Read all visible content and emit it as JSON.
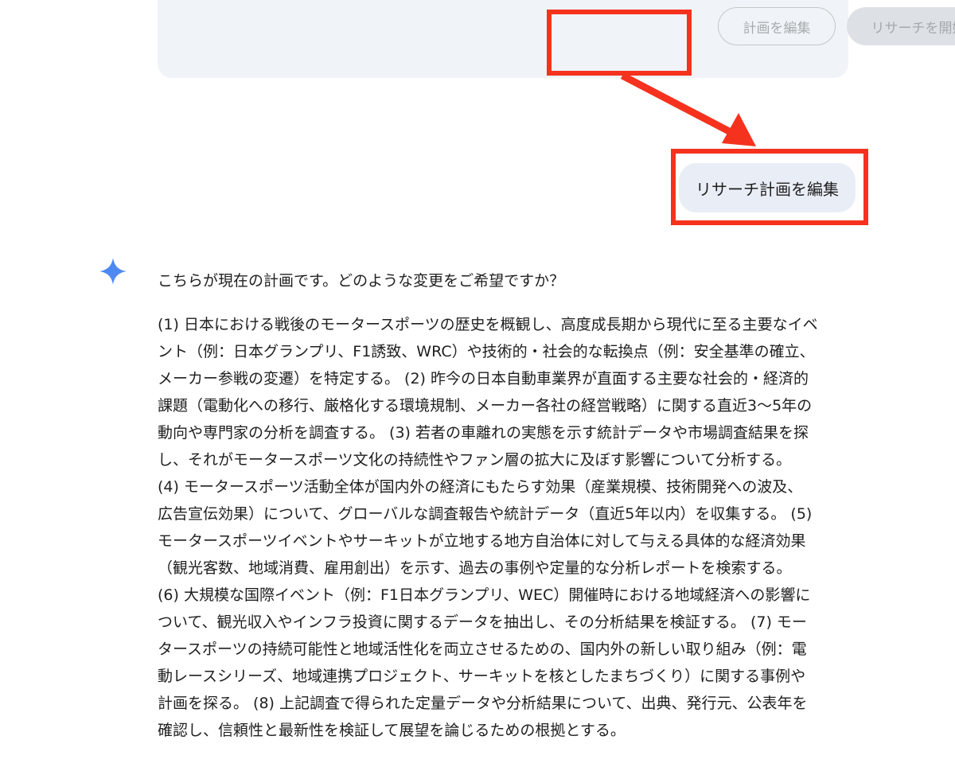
{
  "plan_card": {
    "edit_plan_label": "計画を編集",
    "start_research_label": "リサーチを開始"
  },
  "user_message": "リサーチ計画を編集",
  "assistant": {
    "icon": "gemini-sparkle-icon",
    "intro": "こちらが現在の計画です。どのような変更をご希望ですか？",
    "plan_lines": [
      "(1) 日本における戦後のモータースポーツの歴史を概観し、高度成長期から現代に至る主要なイベ",
      "ント（例：日本グランプリ、F1誘致、WRC）や技術的・社会的な転換点（例：安全基準の確立、",
      "メーカー参戦の変遷）を特定する。 (2) 昨今の日本自動車業界が直面する主要な社会的・経済的",
      "課題（電動化への移行、厳格化する環境規制、メーカー各社の経営戦略）に関する直近3〜5年の",
      "動向や専門家の分析を調査する。 (3) 若者の車離れの実態を示す統計データや市場調査結果を探",
      "し、それがモータースポーツ文化の持続性やファン層の拡大に及ぼす影響について分析する。",
      "(4) モータースポーツ活動全体が国内外の経済にもたらす効果（産業規模、技術開発への波及、",
      "広告宣伝効果）について、グローバルな調査報告や統計データ（直近5年以内）を収集する。 (5)",
      "モータースポーツイベントやサーキットが立地する地方自治体に対して与える具体的な経済効果",
      "（観光客数、地域消費、雇用創出）を示す、過去の事例や定量的な分析レポートを検索する。",
      "(6) 大規模な国際イベント（例：F1日本グランプリ、WEC）開催時における地域経済への影響に",
      "ついて、観光収入やインフラ投資に関するデータを抽出し、その分析結果を検証する。 (7) モー",
      "タースポーツの持続可能性と地域活性化を両立させるための、国内外の新しい取り組み（例：電",
      "動レースシリーズ、地域連携プロジェクト、サーキットを核としたまちづくり）に関する事例や",
      "計画を探る。 (8) 上記調査で得られた定量データや分析結果について、出典、発行元、公表年を",
      "確認し、信頼性と最新性を検証して展望を論じるための根拠とする。"
    ]
  },
  "colors": {
    "highlight": "#f5321e",
    "card_bg": "#f0f4f9",
    "bubble_bg": "#e9eef6",
    "sparkle": "#4285f4"
  }
}
